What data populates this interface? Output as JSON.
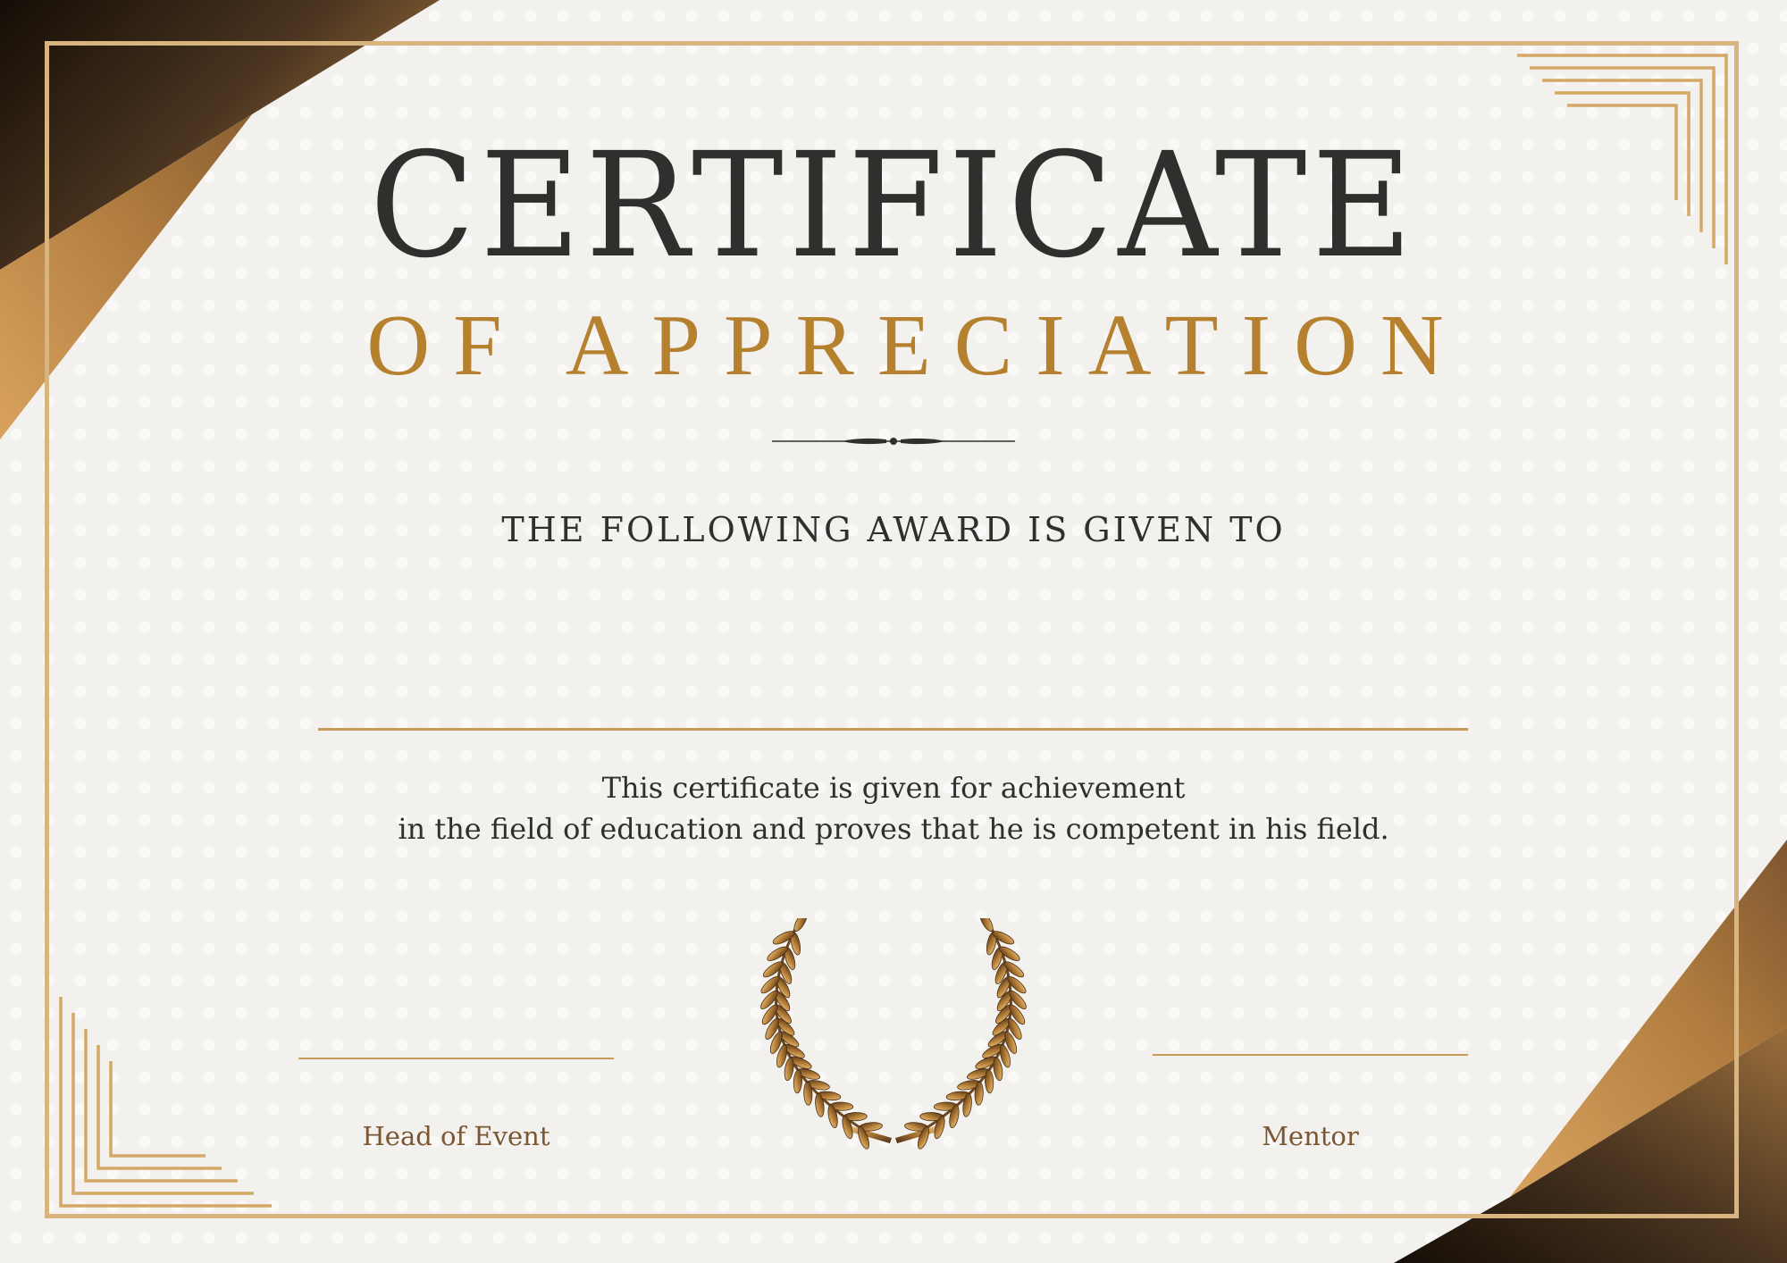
{
  "certificate": {
    "title": "CERTIFICATE",
    "subtitle": "OF APPRECIATION",
    "award_line": "THE FOLLOWING AWARD IS GIVEN TO",
    "description_line1": "This certificate is given for achievement",
    "description_line2": "in the field of education and proves that he is competent in his field.",
    "signature_left_label": "Head of Event",
    "signature_right_label": "Mentor"
  },
  "colors": {
    "gold": "#b6812f",
    "gold_light": "#d8b47f",
    "dark_text": "#2f2f2d",
    "label_brown": "#7a5632",
    "background": "#f3f1ee"
  },
  "icons": [
    "laurel-wreath-icon",
    "divider-ornament-icon"
  ]
}
